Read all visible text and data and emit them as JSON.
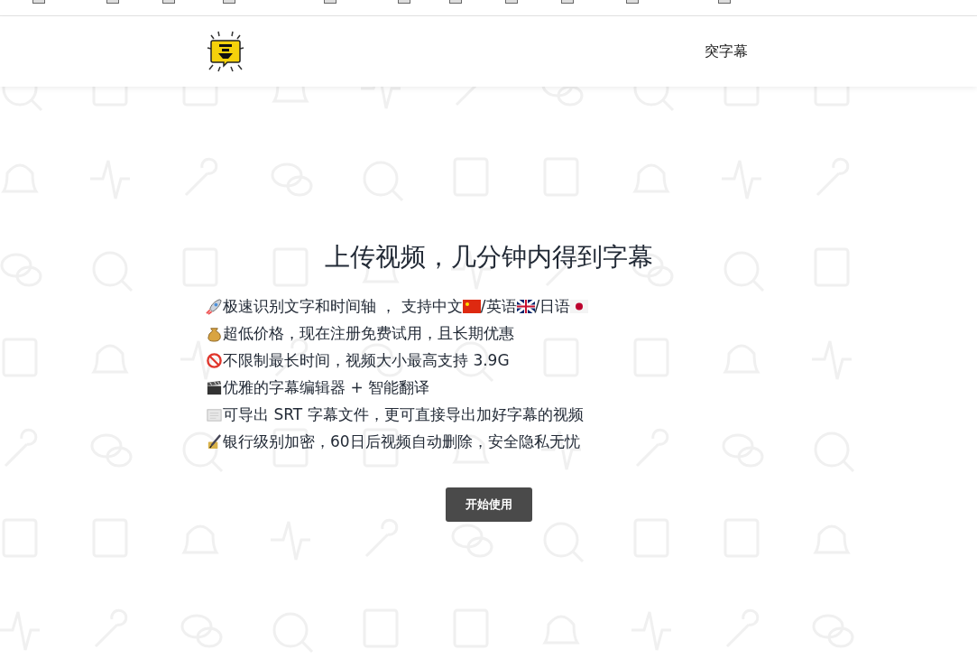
{
  "header": {
    "nav": "突字幕"
  },
  "hero": {
    "title": "上传视频，几分钟内得到字幕",
    "features": [
      {
        "kind": "rocket",
        "parts": [
          {
            "kind": "text",
            "text": "极速识别文字和时间轴 ， 支持中文"
          },
          {
            "kind": "flag-cn"
          },
          {
            "kind": "text",
            "text": "/英语"
          },
          {
            "kind": "flag-uk"
          },
          {
            "kind": "text",
            "text": "/日语"
          },
          {
            "kind": "flag-jp"
          }
        ]
      },
      {
        "kind": "money",
        "parts": [
          {
            "kind": "text",
            "text": "超低价格，现在注册免费试用，且长期优惠"
          }
        ]
      },
      {
        "kind": "prohibited",
        "parts": [
          {
            "kind": "text",
            "text": "不限制最长时间，视频大小最高支持 3.9G"
          }
        ]
      },
      {
        "kind": "clapper",
        "parts": [
          {
            "kind": "text",
            "text": "优雅的字幕编辑器 + 智能翻译"
          }
        ]
      },
      {
        "kind": "scroll",
        "parts": [
          {
            "kind": "text",
            "text": "可导出 SRT 字幕文件，更可直接导出加好字幕的视频"
          }
        ]
      },
      {
        "kind": "lock",
        "parts": [
          {
            "kind": "text",
            "text": "银行级别加密，60日后视频自动删除，安全隐私无忧"
          }
        ]
      }
    ],
    "button": "开始使用"
  }
}
